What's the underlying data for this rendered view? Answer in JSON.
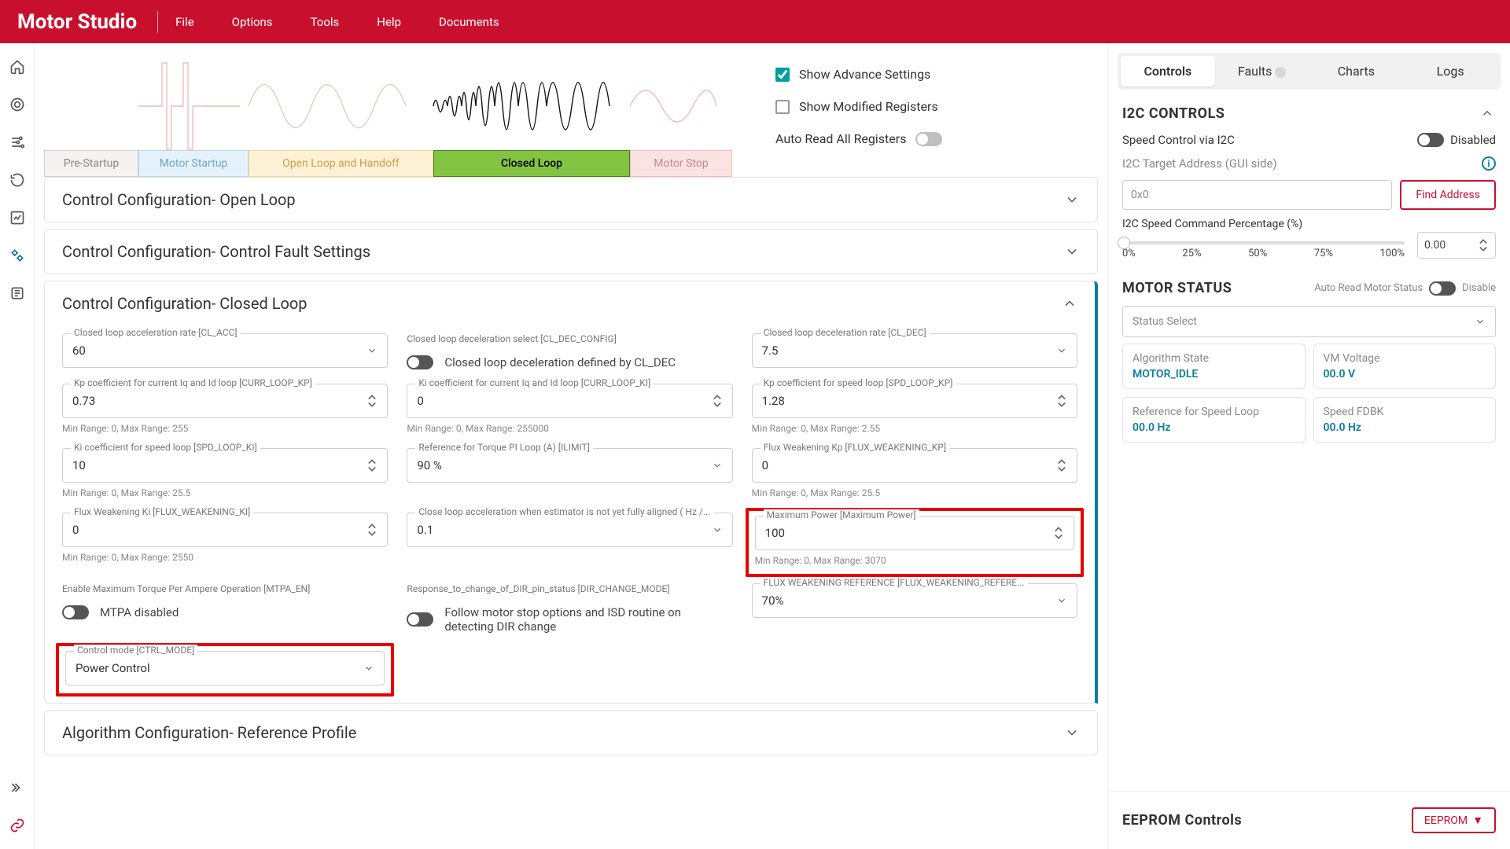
{
  "brand": "Motor Studio",
  "menu": [
    "File",
    "Options",
    "Tools",
    "Help",
    "Documents"
  ],
  "stages": {
    "pre": "Pre-Startup",
    "start": "Motor Startup",
    "open": "Open Loop and Handoff",
    "closed": "Closed Loop",
    "stop": "Motor Stop"
  },
  "options": {
    "advance": "Show Advance Settings",
    "modified": "Show Modified Registers",
    "autoread": "Auto Read All Registers"
  },
  "panels": {
    "openloop": "Control Configuration- Open Loop",
    "fault": "Control Configuration- Control Fault Settings",
    "closed": "Control Configuration- Closed Loop",
    "refprof": "Algorithm Configuration- Reference Profile"
  },
  "closed": {
    "cl_acc": {
      "legend": "Closed loop acceleration rate [CL_ACC]",
      "value": "60"
    },
    "cl_dec_cfg": {
      "legend": "Closed loop deceleration select [CL_DEC_CONFIG]",
      "text": "Closed loop deceleration defined by CL_DEC"
    },
    "cl_dec": {
      "legend": "Closed loop deceleration rate [CL_DEC]",
      "value": "7.5"
    },
    "kp_curr": {
      "legend": "Kp coefficient for current Iq and Id loop [CURR_LOOP_KP]",
      "value": "0.73",
      "hint": "Min Range: 0, Max Range: 255"
    },
    "ki_curr": {
      "legend": "Ki coefficient for current Iq and Id loop [CURR_LOOP_KI]",
      "value": "0",
      "hint": "Min Range: 0, Max Range: 255000"
    },
    "kp_spd": {
      "legend": "Kp coefficient for speed loop [SPD_LOOP_KP]",
      "value": "1.28",
      "hint": "Min Range: 0, Max Range: 2.55"
    },
    "ki_spd": {
      "legend": "Ki coefficient for speed loop [SPD_LOOP_KI]",
      "value": "10",
      "hint": "Min Range: 0, Max Range: 25.5"
    },
    "ilim": {
      "legend": "Reference for Torque PI Loop (A) [ILIMIT]",
      "value": "90 %"
    },
    "fw_kp": {
      "legend": "Flux Weakening Kp [FLUX_WEAKENING_KP]",
      "value": "0",
      "hint": "Min Range: 0, Max Range: 25.5"
    },
    "fw_ki": {
      "legend": "Flux Weakening Ki [FLUX_WEAKENING_KI]",
      "value": "0",
      "hint": "Min Range: 0, Max Range: 2550"
    },
    "cl_acc_na": {
      "legend": "Close loop acceleration when estimator is not yet fully aligned ( Hz /...",
      "value": "0.1"
    },
    "maxpow": {
      "legend": "Maximum Power [Maximum Power]",
      "value": "100",
      "hint": "Min Range: 0, Max Range: 3070"
    },
    "mtpa": {
      "legend": "Enable Maximum Torque Per Ampere Operation [MTPA_EN]",
      "text": "MTPA disabled"
    },
    "dir_chg": {
      "legend": "Response_to_change_of_DIR_pin_status [DIR_CHANGE_MODE]",
      "text": "Follow motor stop options and ISD routine on detecting DIR change"
    },
    "fw_ref": {
      "legend": "FLUX WEAKENING REFERENCE [FLUX_WEAKENING_REFERE...",
      "value": "70%"
    },
    "ctrl_mode": {
      "legend": "Control mode [CTRL_MODE]",
      "value": "Power Control"
    }
  },
  "right": {
    "tabs": {
      "controls": "Controls",
      "faults": "Faults",
      "charts": "Charts",
      "logs": "Logs"
    },
    "i2c": {
      "title": "I2C CONTROLS",
      "speed_label": "Speed Control via I2C",
      "disabled": "Disabled",
      "target_label": "I2C Target Address (GUI side)",
      "target_ph": "0x0",
      "find_btn": "Find Address",
      "speed_cmd_label": "I2C Speed Command Percentage (%)",
      "ticks": [
        "0%",
        "25%",
        "50%",
        "75%",
        "100%"
      ],
      "pct_value": "0.00"
    },
    "motor": {
      "title": "MOTOR STATUS",
      "autoread_label": "Auto Read Motor Status",
      "disable": "Disable",
      "status_select": "Status Select",
      "cards": {
        "alg_label": "Algorithm State",
        "alg_value": "MOTOR_IDLE",
        "vm_label": "VM Voltage",
        "vm_value": "00.0 V",
        "ref_label": "Reference for Speed Loop",
        "ref_value": "00.0 Hz",
        "fdbk_label": "Speed FDBK",
        "fdbk_value": "00.0 Hz"
      }
    },
    "eeprom": {
      "title": "EEPROM Controls",
      "btn": "EEPROM"
    }
  }
}
